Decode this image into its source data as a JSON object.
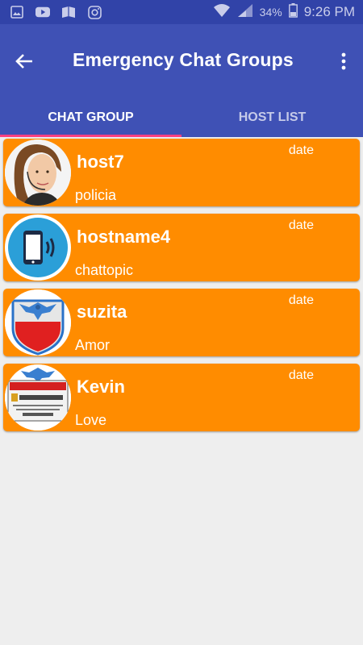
{
  "status_bar": {
    "battery": "34%",
    "time": "9:26 PM"
  },
  "toolbar": {
    "title": "Emergency Chat Groups"
  },
  "tabs": [
    {
      "label": "CHAT GROUP",
      "active": true
    },
    {
      "label": "HOST LIST",
      "active": false
    }
  ],
  "groups": [
    {
      "name": "host7",
      "topic": "policia",
      "date": "date",
      "avatar": "woman-headset-photo"
    },
    {
      "name": "hostname4",
      "topic": "chattopic",
      "date": "date",
      "avatar": "phone-signal-icon"
    },
    {
      "name": "suzita",
      "topic": "Amor",
      "date": "date",
      "avatar": "eagle-shield-icon"
    },
    {
      "name": "Kevin",
      "topic": "Love",
      "date": "date",
      "avatar": "warning-security-sign"
    }
  ],
  "colors": {
    "status_bar": "#3143a8",
    "primary": "#3f51b5",
    "accent": "#ff4081",
    "card": "#ff8c00",
    "background": "#eeeeee"
  }
}
